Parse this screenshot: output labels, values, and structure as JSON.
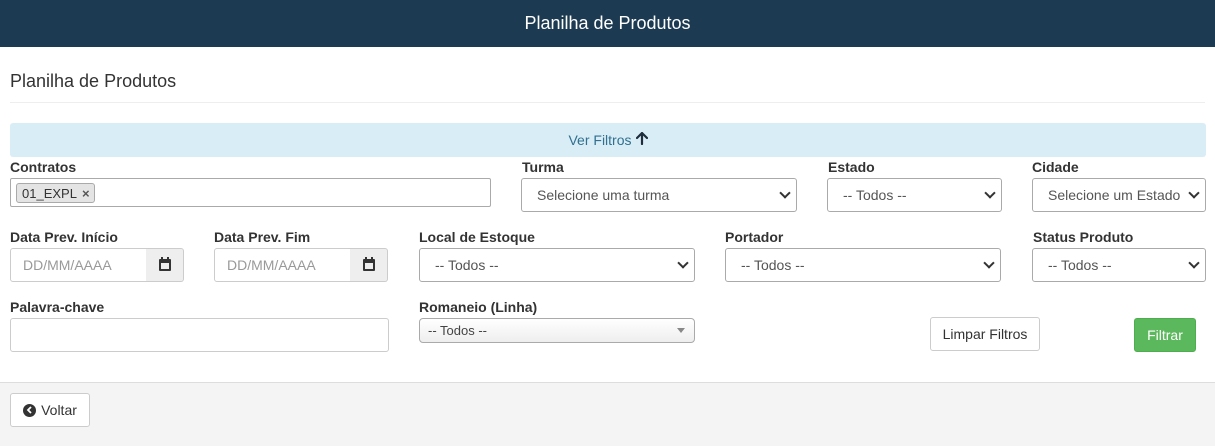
{
  "header": {
    "title": "Planilha de Produtos"
  },
  "page": {
    "heading": "Planilha de Produtos"
  },
  "filters_toggle": {
    "label": "Ver Filtros",
    "arrow": "🡡"
  },
  "fields": {
    "contratos": {
      "label": "Contratos",
      "tags": [
        "01_EXPL"
      ],
      "remove_glyph": "×"
    },
    "turma": {
      "label": "Turma",
      "value": "Selecione uma turma"
    },
    "estado": {
      "label": "Estado",
      "value": "-- Todos --"
    },
    "cidade": {
      "label": "Cidade",
      "value": "Selecione um Estado"
    },
    "data_inicio": {
      "label": "Data Prev. Início",
      "placeholder": "DD/MM/AAAA"
    },
    "data_fim": {
      "label": "Data Prev. Fim",
      "placeholder": "DD/MM/AAAA"
    },
    "local_estoque": {
      "label": "Local de Estoque",
      "value": "-- Todos --"
    },
    "portador": {
      "label": "Portador",
      "value": "-- Todos --"
    },
    "status_produto": {
      "label": "Status Produto",
      "value": "-- Todos --"
    },
    "palavra_chave": {
      "label": "Palavra-chave",
      "value": ""
    },
    "romaneio": {
      "label": "Romaneio (Linha)",
      "value": "-- Todos --"
    }
  },
  "actions": {
    "clear_label": "Limpar Filtros",
    "filter_label": "Filtrar"
  },
  "footer": {
    "back_label": "Voltar",
    "back_glyph": "◀"
  },
  "colors": {
    "topbar": "#1c3a52",
    "filters_bar": "#d9edf7",
    "filter_button": "#5cb85c"
  }
}
